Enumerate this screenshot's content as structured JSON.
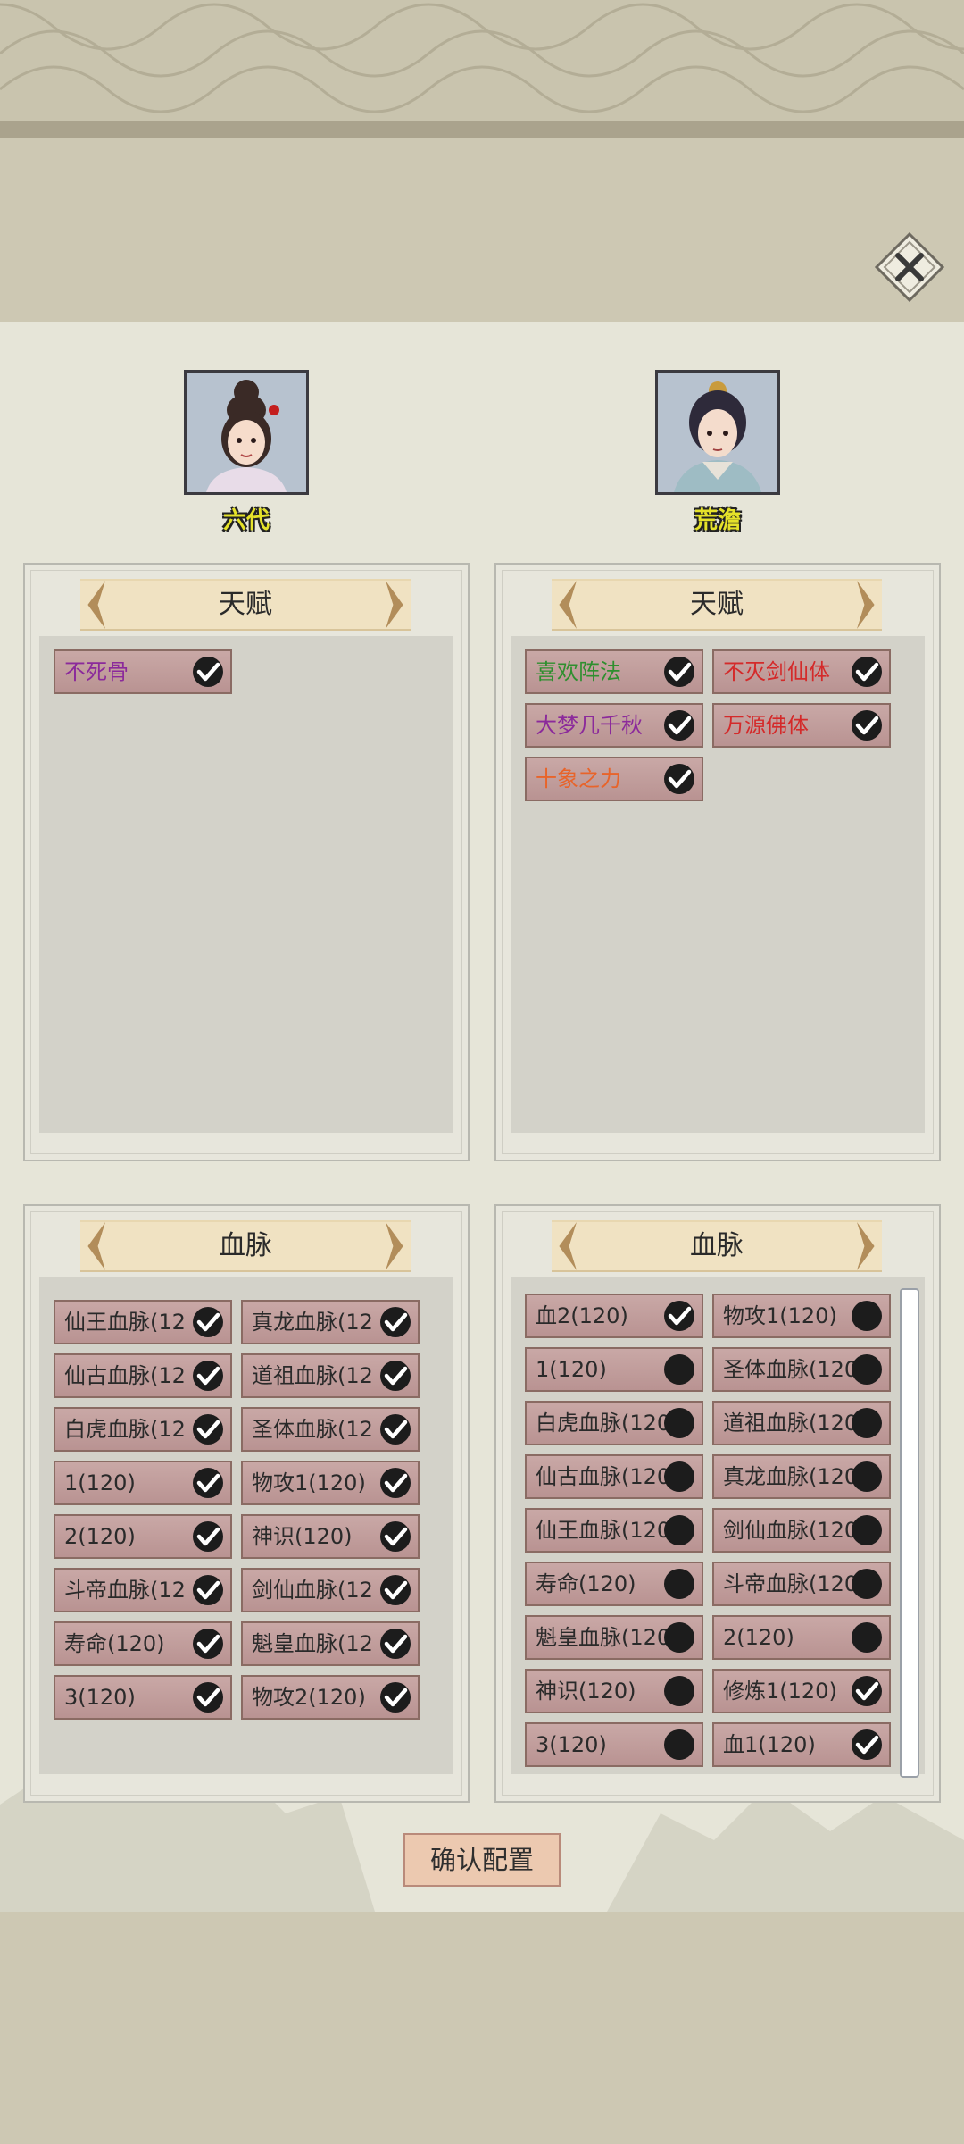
{
  "characters": [
    {
      "name": "六代"
    },
    {
      "name": "荒澹"
    }
  ],
  "panels": {
    "talent_title": "天赋",
    "bloodline_title": "血脉",
    "left_talents": [
      {
        "label": "不死骨",
        "color": "#8b2a9b",
        "checked": true
      }
    ],
    "right_talents": [
      {
        "label": "喜欢阵法",
        "color": "#2f8f2f",
        "checked": true
      },
      {
        "label": "不灭剑仙体",
        "color": "#d42a2a",
        "checked": true
      },
      {
        "label": "大梦几千秋",
        "color": "#8b2a9b",
        "checked": true
      },
      {
        "label": "万源佛体",
        "color": "#d42a2a",
        "checked": true
      },
      {
        "label": "十象之力",
        "color": "#e8642a",
        "checked": true
      }
    ],
    "left_bloodlines": [
      {
        "label": "仙王血脉(12",
        "checked": true
      },
      {
        "label": "真龙血脉(12",
        "checked": true
      },
      {
        "label": "仙古血脉(12",
        "checked": true
      },
      {
        "label": "道祖血脉(12",
        "checked": true
      },
      {
        "label": "白虎血脉(12",
        "checked": true
      },
      {
        "label": "圣体血脉(12",
        "checked": true
      },
      {
        "label": "1(120)",
        "checked": true
      },
      {
        "label": "物攻1(120)",
        "checked": true
      },
      {
        "label": "2(120)",
        "checked": true
      },
      {
        "label": "神识(120)",
        "checked": true
      },
      {
        "label": "斗帝血脉(12",
        "checked": true
      },
      {
        "label": "剑仙血脉(12",
        "checked": true
      },
      {
        "label": "寿命(120)",
        "checked": true
      },
      {
        "label": "魁皇血脉(12",
        "checked": true
      },
      {
        "label": "3(120)",
        "checked": true
      },
      {
        "label": "物攻2(120)",
        "checked": true
      }
    ],
    "right_bloodlines": [
      {
        "label": "血2(120)",
        "checked": true
      },
      {
        "label": "物攻1(120)",
        "checked": false
      },
      {
        "label": "1(120)",
        "checked": false
      },
      {
        "label": "圣体血脉(120",
        "checked": false
      },
      {
        "label": "白虎血脉(120",
        "checked": false
      },
      {
        "label": "道祖血脉(120",
        "checked": false
      },
      {
        "label": "仙古血脉(120",
        "checked": false
      },
      {
        "label": "真龙血脉(120",
        "checked": false
      },
      {
        "label": "仙王血脉(120",
        "checked": false
      },
      {
        "label": "剑仙血脉(120",
        "checked": false
      },
      {
        "label": "寿命(120)",
        "checked": false
      },
      {
        "label": "斗帝血脉(120",
        "checked": false
      },
      {
        "label": "魁皇血脉(120",
        "checked": false
      },
      {
        "label": "2(120)",
        "checked": false
      },
      {
        "label": "神识(120)",
        "checked": false
      },
      {
        "label": "修炼1(120)",
        "checked": true
      },
      {
        "label": "3(120)",
        "checked": false
      },
      {
        "label": "血1(120)",
        "checked": true
      }
    ]
  },
  "confirm_label": "确认配置",
  "icons": {
    "close": "close-icon",
    "check": "checkmark-icon",
    "unchecked": "empty-circle-icon"
  }
}
